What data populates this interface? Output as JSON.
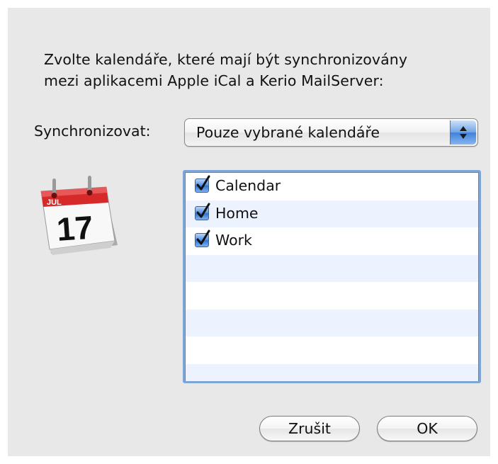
{
  "dialog": {
    "intro_line1": "Zvolte kalendáře, které mají být synchronizovány",
    "intro_line2": "mezi aplikacemi Apple iCal a Kerio MailServer:",
    "sync_label": "Synchronizovat:",
    "sync_popup_value": "Pouze vybrané kalendáře",
    "app_icon": {
      "name": "ical-icon",
      "month": "JUL",
      "day": "17"
    },
    "calendars": [
      {
        "label": "Calendar",
        "checked": true
      },
      {
        "label": "Home",
        "checked": true
      },
      {
        "label": "Work",
        "checked": true
      }
    ],
    "cancel_label": "Zrušit",
    "ok_label": "OK"
  },
  "colors": {
    "dialog_bg": "#e8e8e8",
    "accent_blue": "#3f80da",
    "list_alt_row": "#edf3fe"
  }
}
